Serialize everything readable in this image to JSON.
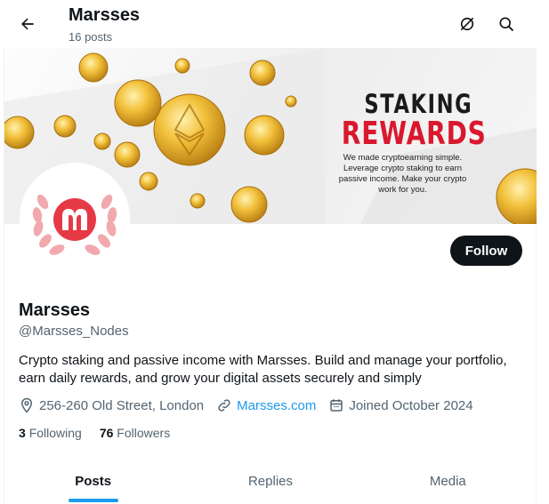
{
  "header": {
    "title": "Marsses",
    "post_count": "16 posts",
    "back_icon": "arrow-left-icon",
    "icons": [
      "grok-icon",
      "search-icon"
    ]
  },
  "banner": {
    "headline_1": "STAKING",
    "headline_2": "REWARDS",
    "tagline": "We made cryptoearning simple. Leverage crypto staking to earn passive income. Make your crypto work for you.",
    "accent_color": "#d9182d"
  },
  "profile": {
    "name": "Marsses",
    "handle": "@Marsses_Nodes",
    "bio": "Crypto staking and passive income with Marsses. Build and manage your portfolio, earn daily rewards, and grow your digital assets securely and simply",
    "location": "256-260 Old Street, London",
    "website": "Marsses.com",
    "joined": "Joined October 2024",
    "following_count": "3",
    "following_label": "Following",
    "followers_count": "76",
    "followers_label": "Followers",
    "follow_button": "Follow"
  },
  "tabs": [
    {
      "label": "Posts",
      "active": true
    },
    {
      "label": "Replies",
      "active": false
    },
    {
      "label": "Media",
      "active": false
    }
  ],
  "colors": {
    "accent": "#1d9bf0",
    "text": "#0f1419",
    "muted": "#536471"
  }
}
